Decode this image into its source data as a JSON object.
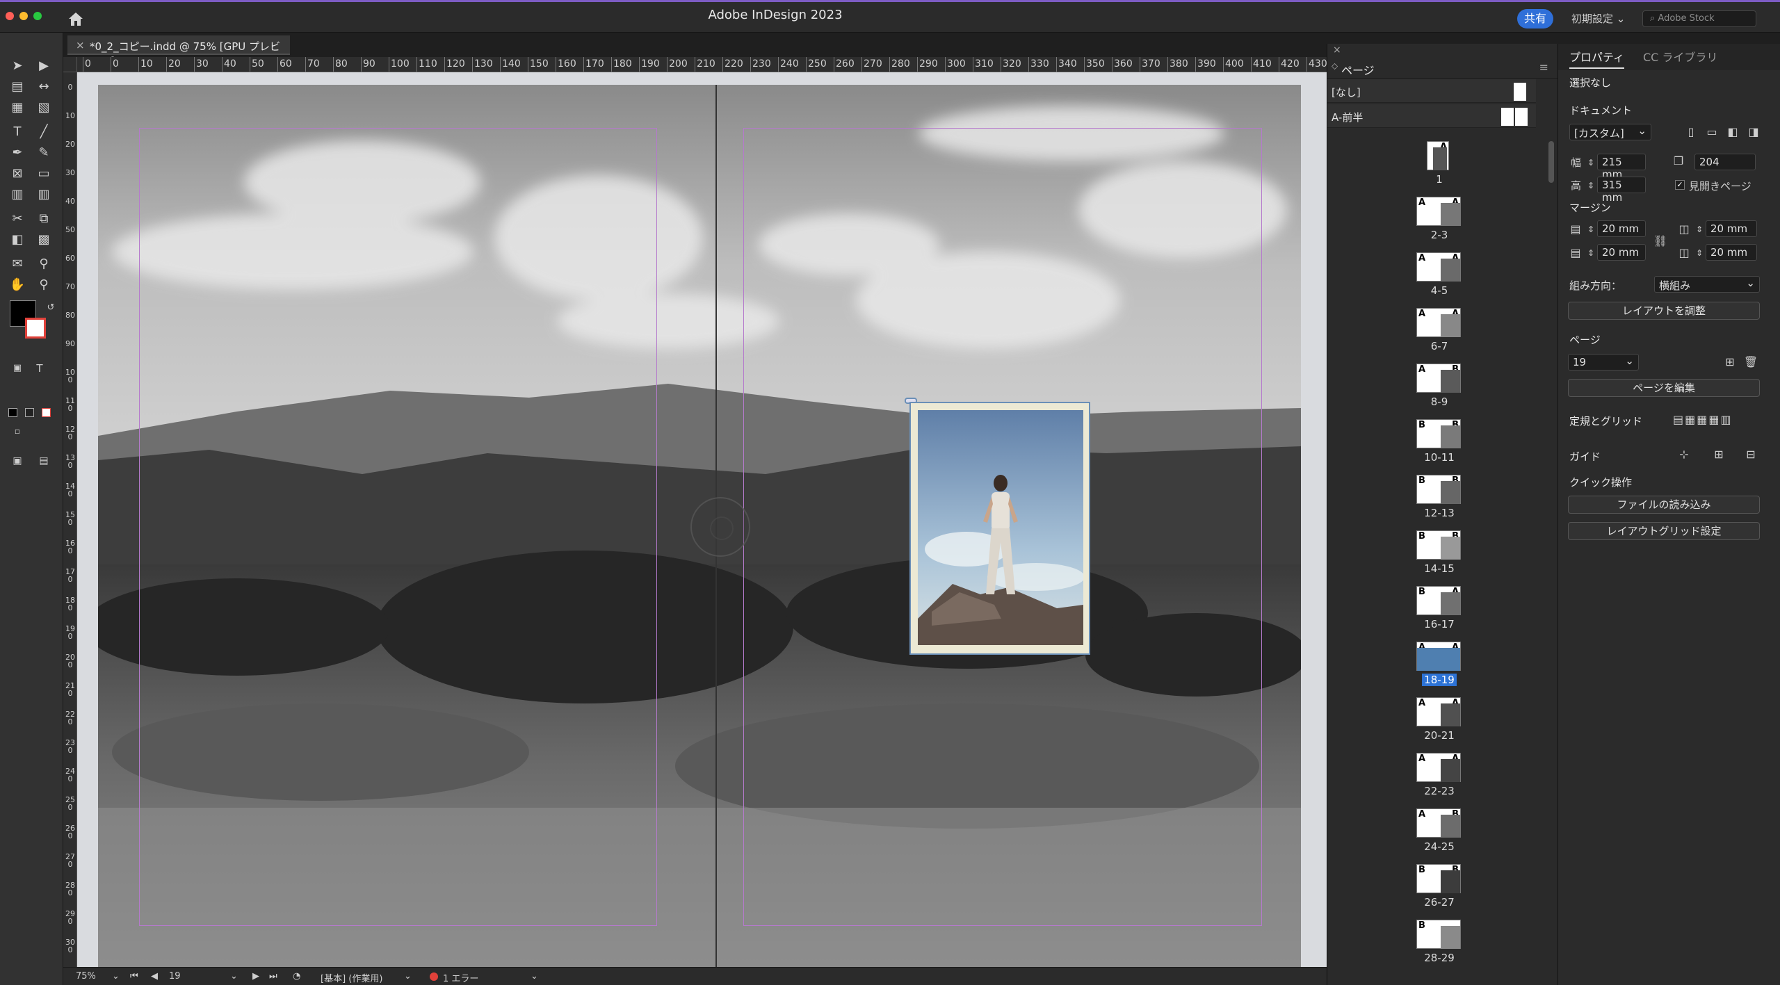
{
  "window": {
    "app_title": "Adobe InDesign 2023",
    "share_label": "共有",
    "workspace_label": "初期設定",
    "stock_placeholder": "Adobe Stock"
  },
  "document_tab": {
    "close_glyph": "×",
    "title": "*0_2_コピー.indd @ 75% [GPU プレビュー]"
  },
  "ruler": {
    "horizontal_ticks": [
      "0",
      "0",
      "10",
      "20",
      "30",
      "40",
      "50",
      "60",
      "70",
      "80",
      "90",
      "100",
      "110",
      "120",
      "130",
      "140",
      "150",
      "160",
      "170",
      "180",
      "190",
      "200",
      "210",
      "220",
      "230",
      "240",
      "250",
      "260",
      "270",
      "280",
      "290",
      "300",
      "310",
      "320",
      "330",
      "340",
      "350",
      "360",
      "370",
      "380",
      "390",
      "400",
      "410",
      "420",
      "430"
    ],
    "vertical_ticks": [
      "0",
      "10",
      "20",
      "30",
      "40",
      "50",
      "60",
      "70",
      "80",
      "90",
      "100",
      "110",
      "120",
      "130",
      "140",
      "150",
      "160",
      "170",
      "180",
      "190",
      "200",
      "210",
      "220",
      "230",
      "240",
      "250",
      "260",
      "270",
      "280",
      "290",
      "300"
    ]
  },
  "status_bar": {
    "zoom": "75%",
    "page": "19",
    "style": "[基本] (作業用)",
    "errors": "1 エラー"
  },
  "pages_panel": {
    "title": "ページ",
    "masters": [
      {
        "label": "[なし]"
      },
      {
        "label": "A-前半"
      }
    ],
    "pages": [
      {
        "label": "1",
        "left_master": "",
        "right_master": "A"
      },
      {
        "label": "2-3",
        "left_master": "A",
        "right_master": "A"
      },
      {
        "label": "4-5",
        "left_master": "A",
        "right_master": "A"
      },
      {
        "label": "6-7",
        "left_master": "A",
        "right_master": "A"
      },
      {
        "label": "8-9",
        "left_master": "A",
        "right_master": "B"
      },
      {
        "label": "10-11",
        "left_master": "B",
        "right_master": "B"
      },
      {
        "label": "12-13",
        "left_master": "B",
        "right_master": "B"
      },
      {
        "label": "14-15",
        "left_master": "B",
        "right_master": "B"
      },
      {
        "label": "16-17",
        "left_master": "B",
        "right_master": "A"
      },
      {
        "label": "18-19",
        "left_master": "A",
        "right_master": "A"
      },
      {
        "label": "20-21",
        "left_master": "A",
        "right_master": "A"
      },
      {
        "label": "22-23",
        "left_master": "A",
        "right_master": "A"
      },
      {
        "label": "24-25",
        "left_master": "A",
        "right_master": "B"
      },
      {
        "label": "26-27",
        "left_master": "B",
        "right_master": "B"
      },
      {
        "label": "28-29",
        "left_master": "B",
        "right_master": ""
      }
    ]
  },
  "properties_panel": {
    "tabs": [
      "プロパティ",
      "CC ライブラリ"
    ],
    "selection": "選択なし",
    "document_heading": "ドキュメント",
    "preset": "[カスタム]",
    "width_label": "幅",
    "width_value": "215 mm",
    "height_label": "高",
    "height_value": "315 mm",
    "page_count": "204",
    "facing_pages_label": "見開きページ",
    "margin_heading": "マージン",
    "margin_top": "20 mm",
    "margin_bottom": "20 mm",
    "margin_inside": "20 mm",
    "margin_outside": "20 mm",
    "orientation_label": "組み方向：",
    "orientation_value": "横組み",
    "adjust_layout_button": "レイアウトを調整",
    "page_heading": "ページ",
    "page_value": "19",
    "edit_page_button": "ページを編集",
    "rulers_grids_heading": "定規とグリッド",
    "guides_heading": "ガイド",
    "quick_actions_heading": "クイック操作",
    "import_file_button": "ファイルの読み込み",
    "layout_grid_button": "レイアウトグリッド設定"
  },
  "colors": {
    "accent": "#2d73d6",
    "title_bar_line": "#7d5cc4",
    "error_dot": "#e0413a"
  }
}
